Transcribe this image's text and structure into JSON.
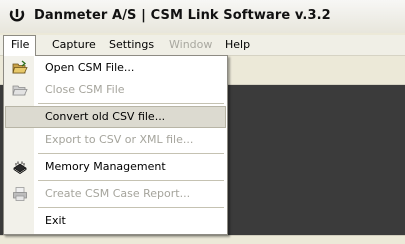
{
  "window": {
    "title": "Danmeter A/S | CSM Link Software v.3.2"
  },
  "menubar": {
    "items": [
      {
        "label": "File",
        "state": "open"
      },
      {
        "label": "Capture",
        "state": "enabled"
      },
      {
        "label": "Settings",
        "state": "enabled"
      },
      {
        "label": "Window",
        "state": "disabled"
      },
      {
        "label": "Help",
        "state": "enabled"
      }
    ]
  },
  "file_menu": {
    "items": [
      {
        "label": "Open CSM File...",
        "icon": "open-folder-icon",
        "enabled": true
      },
      {
        "label": "Close CSM File",
        "icon": "close-folder-icon",
        "enabled": false
      },
      {
        "label": "Convert old CSV file...",
        "icon": "",
        "enabled": true,
        "highlighted": true
      },
      {
        "label": "Export to CSV or XML file...",
        "icon": "",
        "enabled": false
      },
      {
        "label": "Memory Management",
        "icon": "memory-chip-icon",
        "enabled": true
      },
      {
        "label": "Create CSM Case Report...",
        "icon": "printer-icon",
        "enabled": false
      },
      {
        "label": "Exit",
        "icon": "",
        "enabled": true
      }
    ]
  },
  "colors": {
    "workspace": "#3b3b3b",
    "menu_highlight": "#dcdad0",
    "disabled_text": "#a5a49c"
  }
}
